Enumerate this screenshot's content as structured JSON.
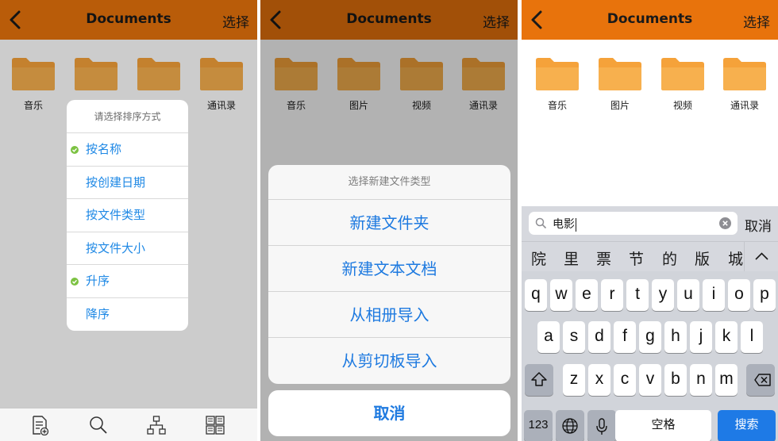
{
  "colors": {
    "accent": "#e8730c",
    "link": "#1e7ae0",
    "check": "#7cc242",
    "folder": "#f5a23a"
  },
  "panel1": {
    "title": "Documents",
    "right": "选择",
    "folders": [
      "音乐",
      "通讯录"
    ],
    "sort": {
      "header": "请选择排序方式",
      "items": [
        {
          "label": "按名称",
          "checked": true
        },
        {
          "label": "按创建日期",
          "checked": false
        },
        {
          "label": "按文件类型",
          "checked": false
        },
        {
          "label": "按文件大小",
          "checked": false
        },
        {
          "label": "升序",
          "checked": true
        },
        {
          "label": "降序",
          "checked": false
        }
      ]
    },
    "tabs": [
      "new-file-icon",
      "search-icon",
      "sitemap-icon",
      "grid-icon"
    ]
  },
  "panel2": {
    "title": "Documents",
    "right": "选择",
    "folders": [
      "音乐",
      "图片",
      "视频",
      "通讯录"
    ],
    "sheet": {
      "header": "选择新建文件类型",
      "items": [
        "新建文件夹",
        "新建文本文档",
        "从相册导入",
        "从剪切板导入"
      ],
      "cancel": "取消"
    }
  },
  "panel3": {
    "title": "Documents",
    "right": "选择",
    "folders": [
      "音乐",
      "图片",
      "视频",
      "通讯录"
    ],
    "search": {
      "value": "电影",
      "cancel": "取消"
    },
    "candidates": [
      "院",
      "里",
      "票",
      "节",
      "的",
      "版",
      "城"
    ],
    "keyboard": {
      "row1": [
        "q",
        "w",
        "e",
        "r",
        "t",
        "y",
        "u",
        "i",
        "o",
        "p"
      ],
      "row2": [
        "a",
        "s",
        "d",
        "f",
        "g",
        "h",
        "j",
        "k",
        "l"
      ],
      "row3": [
        "z",
        "x",
        "c",
        "v",
        "b",
        "n",
        "m"
      ],
      "numbers": "123",
      "space": "空格",
      "search": "搜索"
    }
  }
}
